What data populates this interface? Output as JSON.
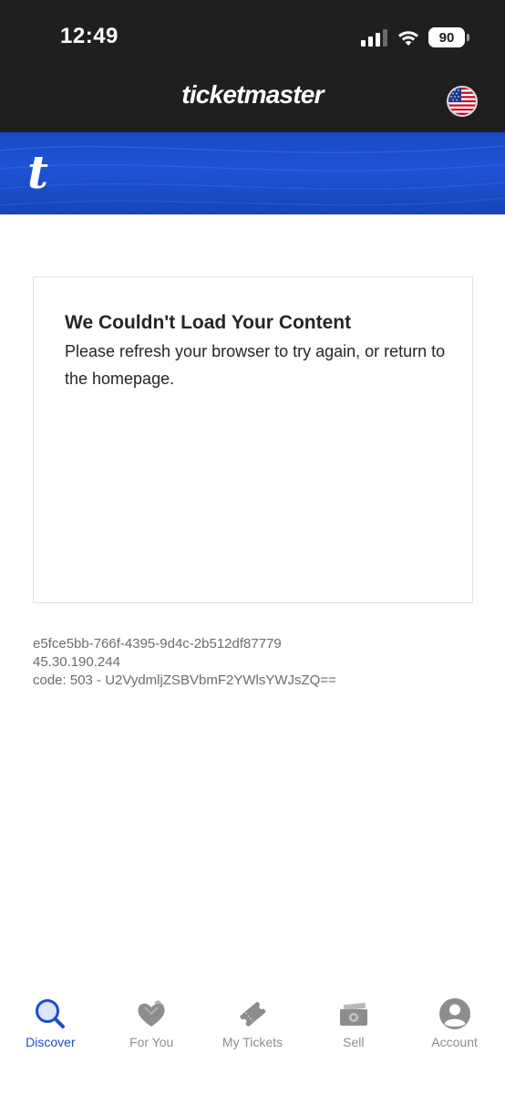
{
  "status_bar": {
    "time": "12:49",
    "battery": "90"
  },
  "header": {
    "brand": "ticketmaster"
  },
  "banner": {
    "logo": "t"
  },
  "error": {
    "title": "We Couldn't Load Your Content",
    "message": "Please refresh your browser to try again, or return to the homepage."
  },
  "meta": {
    "request_id": "e5fce5bb-766f-4395-9d4c-2b512df87779",
    "ip": "45.30.190.244",
    "code": "code: 503 - U2VydmljZSBVbmF2YWlsYWJsZQ=="
  },
  "nav": {
    "items": [
      {
        "label": "Discover",
        "icon": "search-icon",
        "active": true
      },
      {
        "label": "For You",
        "icon": "heart-icon",
        "active": false
      },
      {
        "label": "My Tickets",
        "icon": "ticket-icon",
        "active": false
      },
      {
        "label": "Sell",
        "icon": "cash-icon",
        "active": false
      },
      {
        "label": "Account",
        "icon": "person-icon",
        "active": false
      }
    ]
  },
  "colors": {
    "accent": "#1b4bd1",
    "header_bg": "#1f1f1f",
    "banner": "#1e52d6",
    "inactive": "#8d8d8d"
  }
}
